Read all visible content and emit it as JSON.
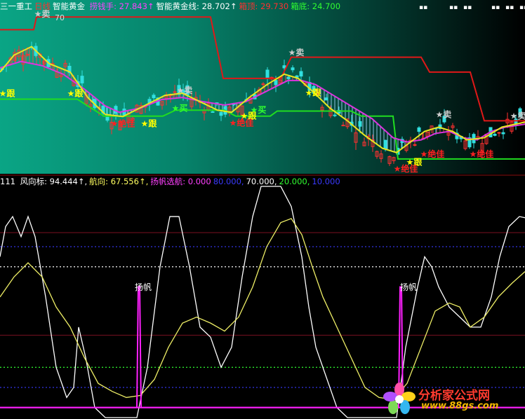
{
  "header_main": {
    "stock": "三一重工",
    "period": "日线",
    "indicator": "智能黄金",
    "items": [
      {
        "label": "捞钱手",
        "value": "27.843↑",
        "color": "#ff40ff"
      },
      {
        "label": "智能黄金线",
        "value": "28.702↑",
        "color": "#ffffff"
      },
      {
        "label": "箱顶",
        "value": "29.730",
        "color": "#ff3030"
      },
      {
        "label": "箱底",
        "value": "24.700",
        "color": "#30ff30"
      }
    ]
  },
  "header_sub": {
    "prefix": "111",
    "items": [
      {
        "label": "风向标",
        "value": "94.444↑",
        "color": "#ffffff"
      },
      {
        "label": "航向",
        "value": "67.556↑",
        "color": "#ffff60"
      },
      {
        "label": "扬帆选航",
        "value": "0.000",
        "color": "#ff40ff"
      }
    ],
    "levels": [
      {
        "value": "80.000",
        "color": "#3a3aff"
      },
      {
        "value": "70.000",
        "color": "#ffffff"
      },
      {
        "value": "20.000",
        "color": "#30ff30"
      },
      {
        "value": "10.000",
        "color": "#3a3aff"
      }
    ]
  },
  "chart_data": [
    {
      "type": "candlestick",
      "title": "智能黄金",
      "series": [
        {
          "name": "箱顶",
          "color": "#e01818",
          "x": [
            0,
            48,
            52,
            300,
            318,
            400,
            415,
            600,
            612,
            670,
            690,
            748
          ],
          "y": [
            30.6,
            30.6,
            30.9,
            30.9,
            29.45,
            29.45,
            29.95,
            29.95,
            29.6,
            29.6,
            28.45,
            28.45
          ]
        },
        {
          "name": "箱底",
          "color": "#20dd20",
          "x": [
            0,
            110,
            148,
            232,
            250,
            320,
            336,
            385,
            395,
            500,
            515,
            560,
            567,
            748
          ],
          "y": [
            28.96,
            28.96,
            28.56,
            28.56,
            28.7,
            28.7,
            28.56,
            28.56,
            28.68,
            28.68,
            28.56,
            28.56,
            27.55,
            27.55
          ]
        },
        {
          "name": "智能黄金线",
          "color": "#dd33dd",
          "x": [
            0,
            30,
            60,
            90,
            120,
            150,
            170,
            200,
            230,
            260,
            290,
            320,
            350,
            380,
            410,
            430,
            450,
            470,
            500,
            530,
            560,
            580,
            600,
            620,
            640,
            660,
            680,
            700,
            720,
            748
          ],
          "y": [
            29.7,
            29.85,
            29.75,
            29.55,
            29.2,
            28.8,
            28.65,
            28.75,
            28.95,
            29.0,
            28.9,
            28.82,
            28.9,
            29.15,
            29.4,
            29.4,
            29.3,
            29.1,
            28.8,
            28.5,
            28.05,
            27.95,
            28.0,
            28.15,
            28.2,
            28.05,
            28.0,
            28.2,
            28.3,
            28.37
          ]
        },
        {
          "name": "捞钱手",
          "color": "#e8e820",
          "x": [
            0,
            20,
            45,
            70,
            100,
            125,
            150,
            175,
            205,
            235,
            260,
            285,
            310,
            330,
            355,
            380,
            405,
            425,
            445,
            470,
            495,
            520,
            545,
            565,
            585,
            605,
            625,
            645,
            665,
            690,
            715,
            748
          ],
          "y": [
            29.6,
            30.0,
            30.2,
            29.8,
            29.6,
            29.0,
            28.6,
            28.55,
            28.8,
            29.05,
            29.1,
            28.9,
            28.7,
            28.65,
            29.0,
            29.3,
            29.55,
            29.45,
            29.15,
            28.75,
            28.45,
            28.1,
            27.8,
            27.7,
            27.95,
            28.2,
            28.3,
            28.2,
            28.0,
            28.05,
            28.3,
            28.42
          ]
        }
      ],
      "signals": [
        {
          "label": "卖",
          "x": 60,
          "y": 30.9,
          "color": "#cccccc"
        },
        {
          "label": "跟",
          "x": 10,
          "y": 29.03,
          "color": "#ffff00"
        },
        {
          "label": "跟",
          "x": 107,
          "y": 29.03,
          "color": "#ffff00"
        },
        {
          "label": "卖",
          "x": 263,
          "y": 29.1,
          "color": "#cccccc"
        },
        {
          "label": "买",
          "x": 256,
          "y": 28.68,
          "color": "#30ff30"
        },
        {
          "label": "绝佳",
          "x": 175,
          "y": 28.32,
          "color": "#ff2020"
        },
        {
          "label": "跟",
          "x": 212,
          "y": 28.32,
          "color": "#ffff00"
        },
        {
          "label": "卖",
          "x": 422,
          "y": 29.99,
          "color": "#cccccc"
        },
        {
          "label": "跟",
          "x": 446,
          "y": 29.04,
          "color": "#ffff00"
        },
        {
          "label": "买",
          "x": 368,
          "y": 28.64,
          "color": "#30ff30"
        },
        {
          "label": "跟",
          "x": 354,
          "y": 28.5,
          "color": "#ffff00"
        },
        {
          "label": "绝佳",
          "x": 344,
          "y": 28.33,
          "color": "#ff2020"
        },
        {
          "label": "卖",
          "x": 632,
          "y": 28.53,
          "color": "#cccccc"
        },
        {
          "label": "绝佳",
          "x": 616,
          "y": 27.6,
          "color": "#ff2020"
        },
        {
          "label": "绝佳",
          "x": 686,
          "y": 27.6,
          "color": "#ff2020"
        },
        {
          "label": "跟",
          "x": 590,
          "y": 27.41,
          "color": "#ffff00"
        },
        {
          "label": "绝佳",
          "x": 578,
          "y": 27.25,
          "color": "#ff2020"
        },
        {
          "label": "卖",
          "x": 738,
          "y": 28.5,
          "color": "#cccccc"
        }
      ],
      "price_labels": [
        {
          "text": "70",
          "value": 30.9
        }
      ]
    },
    {
      "type": "line",
      "title": "风向标",
      "ylim": [
        0,
        100
      ],
      "hlines": [
        {
          "value": 80,
          "color": "#3a3aff",
          "style": "dotted"
        },
        {
          "value": 70,
          "color": "#ffffff",
          "style": "dotted"
        },
        {
          "value": 20,
          "color": "#30ff30",
          "style": "dotted"
        },
        {
          "value": 10,
          "color": "#3a3aff",
          "style": "dotted"
        }
      ],
      "bands": [
        {
          "value": 87,
          "color": "#7a1020"
        },
        {
          "value": 36,
          "color": "#7a1020"
        }
      ],
      "series": [
        {
          "name": "风向标",
          "color": "#ffffff",
          "x": [
            0,
            8,
            18,
            30,
            40,
            50,
            65,
            80,
            95,
            105,
            112,
            122,
            135,
            150,
            165,
            180,
            195,
            210,
            228,
            242,
            255,
            270,
            285,
            300,
            315,
            330,
            345,
            360,
            372,
            385,
            400,
            415,
            430,
            440,
            450,
            465,
            480,
            495,
            510,
            525,
            540,
            553,
            565,
            578,
            595,
            605,
            615,
            625,
            640,
            655,
            670,
            685,
            700,
            712,
            725,
            740,
            748
          ],
          "y": [
            75,
            90,
            95,
            85,
            95,
            85,
            55,
            20,
            5,
            10,
            40,
            25,
            0,
            -5,
            -5,
            -5,
            -5,
            20,
            70,
            95,
            95,
            70,
            40,
            35,
            20,
            30,
            65,
            95,
            110,
            110,
            110,
            100,
            75,
            50,
            30,
            15,
            0,
            -5,
            -5,
            -5,
            -5,
            -5,
            -5,
            30,
            60,
            75,
            70,
            60,
            50,
            45,
            40,
            40,
            55,
            75,
            90,
            95,
            94.4
          ]
        },
        {
          "name": "航向",
          "color": "#eeee66",
          "x": [
            0,
            20,
            40,
            60,
            80,
            100,
            120,
            140,
            160,
            180,
            200,
            220,
            240,
            260,
            280,
            300,
            320,
            340,
            360,
            380,
            400,
            415,
            430,
            445,
            460,
            480,
            500,
            520,
            540,
            560,
            580,
            600,
            620,
            640,
            655,
            670,
            690,
            710,
            730,
            748
          ],
          "y": [
            55,
            65,
            72,
            65,
            50,
            40,
            25,
            12,
            8,
            5,
            6,
            14,
            30,
            42,
            45,
            42,
            38,
            45,
            60,
            80,
            92,
            94,
            86,
            70,
            55,
            40,
            25,
            10,
            5,
            4,
            12,
            30,
            48,
            52,
            50,
            40,
            45,
            55,
            62,
            67.6
          ]
        },
        {
          "name": "扬帆选航",
          "color": "#ff20ff",
          "x": [
            0,
            195,
            197,
            199,
            201,
            203,
            748
          ],
          "y": [
            0,
            0,
            60,
            60,
            0,
            0,
            0
          ]
        },
        {
          "name": "扬帆选航2",
          "color": "#ff20ff",
          "x": [
            0,
            568,
            570,
            572,
            574,
            576,
            748
          ],
          "y": [
            0,
            0,
            60,
            60,
            0,
            0,
            0
          ]
        }
      ],
      "annotations": [
        {
          "text": "扬帆",
          "x": 204,
          "y": 64,
          "color": "#ffffff"
        },
        {
          "text": "扬帆",
          "x": 582,
          "y": 64,
          "color": "#ffffff"
        }
      ]
    }
  ],
  "watermark": {
    "title": "分析家公式网",
    "url": "www.88gs.com"
  }
}
